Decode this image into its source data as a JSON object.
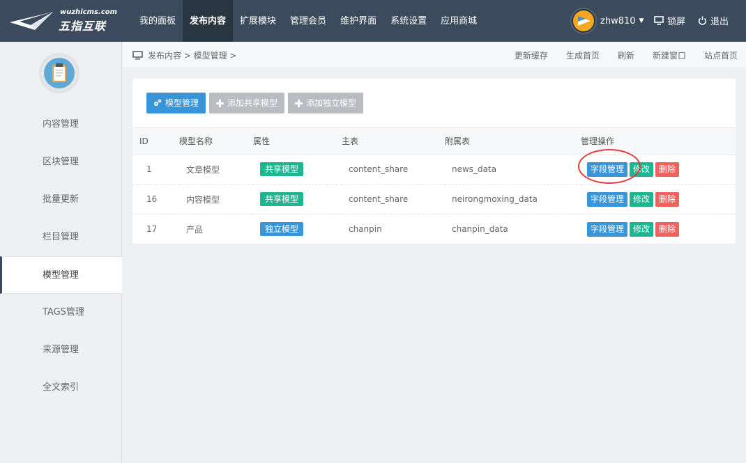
{
  "header": {
    "logo_small": "wuzhicms.com",
    "logo_big": "五指互联",
    "nav": [
      "我的面板",
      "发布内容",
      "扩展模块",
      "管理会员",
      "维护界面",
      "系统设置",
      "应用商城"
    ],
    "active_nav": "发布内容",
    "username": "zhw810",
    "lock_label": "锁屏",
    "logout_label": "退出"
  },
  "sidebar": {
    "items": [
      "内容管理",
      "区块管理",
      "批量更新",
      "栏目管理",
      "模型管理",
      "TAGS管理",
      "来源管理",
      "全文索引"
    ],
    "active": "模型管理"
  },
  "breadcrumb": {
    "text": "发布内容 > 模型管理 >",
    "links": [
      "更新缓存",
      "生成首页",
      "刷新",
      "新建窗口",
      "站点首页"
    ]
  },
  "toolbar": {
    "model_manage": "模型管理",
    "add_shared": "添加共享模型",
    "add_independent": "添加独立模型"
  },
  "table": {
    "headers": [
      "ID",
      "模型名称",
      "属性",
      "主表",
      "附属表",
      "管理操作"
    ],
    "rows": [
      {
        "id": "1",
        "name": "文章模型",
        "attr": "共享模型",
        "main": "content_share",
        "sub": "news_data"
      },
      {
        "id": "16",
        "name": "内容模型",
        "attr": "共享模型",
        "main": "content_share",
        "sub": "neirongmoxing_data"
      },
      {
        "id": "17",
        "name": "产品",
        "attr": "独立模型",
        "main": "chanpin",
        "sub": "chanpin_data"
      }
    ],
    "op_field": "字段管理",
    "op_edit": "修改",
    "op_delete": "删除"
  },
  "colors": {
    "topbar": "#3b4a5c",
    "primary": "#3a95d8",
    "green": "#1fb591",
    "red": "#f0625d",
    "highlight": "#e23c3c"
  }
}
